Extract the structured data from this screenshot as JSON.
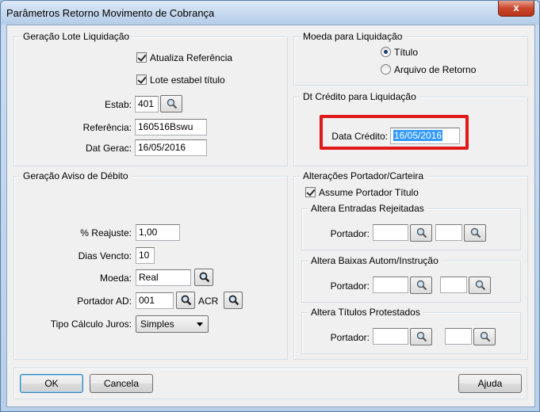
{
  "window": {
    "title": "Parâmetros Retorno Movimento de Cobrança",
    "close_glyph": "x"
  },
  "geracao_lote": {
    "legend": "Geração Lote Liquidação",
    "atualiza_referencia": {
      "label": "Atualiza Referência",
      "checked": true
    },
    "lote_estabel": {
      "label": "Lote estabel título",
      "checked": true
    },
    "estab": {
      "label": "Estab:",
      "value": "401"
    },
    "referencia": {
      "label": "Referência:",
      "value": "160516Bswu"
    },
    "dat_gerac": {
      "label": "Dat Gerac:",
      "value": "16/05/2016"
    }
  },
  "moeda_liquidacao": {
    "legend": "Moeda para Liquidação",
    "options": [
      {
        "label": "Título",
        "selected": true
      },
      {
        "label": "Arquivo de Retorno",
        "selected": false
      }
    ]
  },
  "dt_credito": {
    "legend": "Dt Crédito para Liquidação",
    "label": "Data Crédito:",
    "value": "16/05/2016",
    "highlight_color": "#e01818"
  },
  "aviso_debito": {
    "legend": "Geração Aviso de Débito",
    "reajuste": {
      "label": "% Reajuste:",
      "value": "1,00"
    },
    "dias_vencto": {
      "label": "Dias Vencto:",
      "value": "10"
    },
    "moeda": {
      "label": "Moeda:",
      "value": "Real"
    },
    "portador_ad": {
      "label": "Portador AD:",
      "value": "001",
      "suffix": "ACR"
    },
    "tipo_calculo": {
      "label": "Tipo Cálculo Juros:",
      "value": "Simples"
    }
  },
  "alteracoes": {
    "legend": "Alterações Portador/Carteira",
    "assume_portador": {
      "label": "Assume Portador Título",
      "checked": true
    },
    "entradas": {
      "legend": "Altera Entradas Rejeitadas",
      "label": "Portador:"
    },
    "baixas": {
      "legend": "Altera Baixas Autom/Instrução",
      "label": "Portador:"
    },
    "protestados": {
      "legend": "Altera Títulos Protestados",
      "label": "Portador:"
    }
  },
  "buttons": {
    "ok": "OK",
    "cancela": "Cancela",
    "ajuda": "Ajuda"
  },
  "icons": {
    "search": "magnifier-icon",
    "close": "close-icon"
  }
}
